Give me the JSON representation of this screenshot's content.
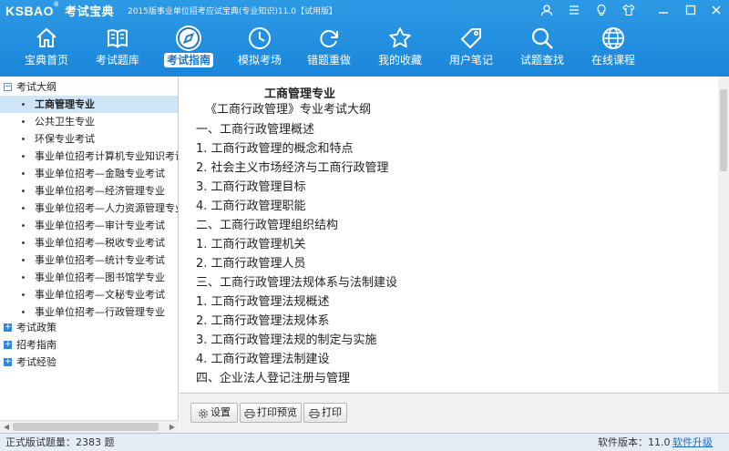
{
  "app": {
    "logo_en": "KSBAO",
    "logo_reg": "®",
    "logo_cn": "考试宝典",
    "window_title": "2015版事业单位招考应试宝典(专业知识)11.0【试用版】"
  },
  "toolbar": {
    "items": [
      {
        "label": "宝典首页",
        "icon": "home-icon"
      },
      {
        "label": "考试题库",
        "icon": "book-icon"
      },
      {
        "label": "考试指南",
        "icon": "compass-icon"
      },
      {
        "label": "模拟考场",
        "icon": "clock-icon"
      },
      {
        "label": "错题重做",
        "icon": "refresh-icon"
      },
      {
        "label": "我的收藏",
        "icon": "star-icon"
      },
      {
        "label": "用户笔记",
        "icon": "tag-icon"
      },
      {
        "label": "试题查找",
        "icon": "search-icon"
      },
      {
        "label": "在线课程",
        "icon": "globe-icon"
      }
    ],
    "active": "考试指南"
  },
  "sidebar": {
    "categories": [
      {
        "label": "考试大纲",
        "expanded": true,
        "children": [
          "工商管理专业",
          "公共卫生专业",
          "环保专业考试",
          "事业单位招考计算机专业知识考试",
          "事业单位招考—金融专业考试",
          "事业单位招考—经济管理专业",
          "事业单位招考—人力资源管理专业",
          "事业单位招考—审计专业考试",
          "事业单位招考—税收专业考试",
          "事业单位招考—统计专业考试",
          "事业单位招考—图书馆学专业",
          "事业单位招考—文秘专业考试",
          "事业单位招考—行政管理专业"
        ],
        "selected": "工商管理专业"
      },
      {
        "label": "考试政策",
        "expanded": false
      },
      {
        "label": "招考指南",
        "expanded": false
      },
      {
        "label": "考试经验",
        "expanded": false
      }
    ]
  },
  "document": {
    "title": "工商管理专业",
    "lines": [
      "《工商行政管理》专业考试大纲",
      "一、工商行政管理概述",
      "1. 工商行政管理的概念和特点",
      "2. 社会主义市场经济与工商行政管理",
      "3. 工商行政管理目标",
      "4. 工商行政管理职能",
      "二、工商行政管理组织结构",
      "1. 工商行政管理机关",
      "2. 工商行政管理人员",
      "三、工商行政管理法规体系与法制建设",
      "1. 工商行政管理法规概述",
      "2. 工商行政管理法规体系",
      "3. 工商行政管理法规的制定与实施",
      "4. 工商行政管理法制建设",
      "四、企业法人登记注册与管理"
    ]
  },
  "actions": {
    "settings": "设置",
    "print_preview": "打印预览",
    "print": "打印"
  },
  "status": {
    "count_label": "正式版试题量：2383 题",
    "version_label": "软件版本：11.0",
    "upgrade_label": "软件升级"
  },
  "colors": {
    "header": "#1b86d9",
    "selected_row": "#cfe6f8",
    "link": "#1b6fc2"
  }
}
